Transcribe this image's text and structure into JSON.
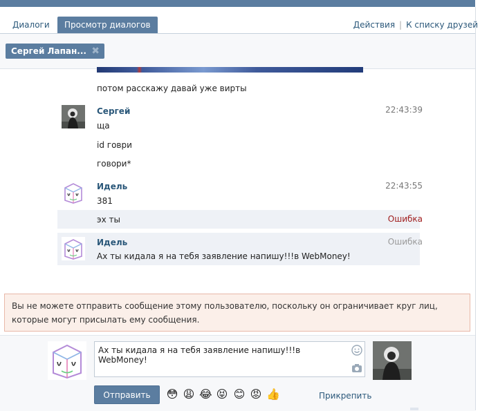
{
  "tabs": {
    "dialogs": "Диалоги",
    "view_dialogs": "Просмотр диалогов"
  },
  "actions": {
    "actions_link": "Действия",
    "friends_link": "К списку друзей",
    "separator": "|"
  },
  "filter_chip": {
    "label": "Сергей Лапан...",
    "close": "✖"
  },
  "messages": [
    {
      "text": "потом расскажу давай уже вирты"
    },
    {
      "author": "Сергей",
      "time": "22:43:39",
      "lines": [
        "ща",
        "id говри",
        "говори*"
      ]
    },
    {
      "author": "Идель",
      "time": "22:43:55",
      "lines": [
        "381"
      ]
    },
    {
      "text": "эх ты",
      "status": "Ошибка"
    },
    {
      "author": "Идель",
      "status": "Ошибка",
      "text": "Ах ты кидала я на тебя заявление напишу!!!в WebMoney!"
    }
  ],
  "notice": "Вы не можете отправить сообщение этому пользователю, поскольку он ограничивает круг лиц, которые могут присылать ему сообщения.",
  "composer": {
    "draft": "Ах ты кидала я на тебя заявление напишу!!!в WebMoney!",
    "send_label": "Отправить",
    "attach_label": "Прикрепить",
    "emojis": [
      "😳",
      "😩",
      "😂",
      "😝",
      "😊",
      "😡",
      "👍"
    ]
  },
  "colors": {
    "accent": "#5b7da0",
    "link": "#2b587a",
    "error": "#a01d1d",
    "notice_bg": "#fbefe9"
  }
}
